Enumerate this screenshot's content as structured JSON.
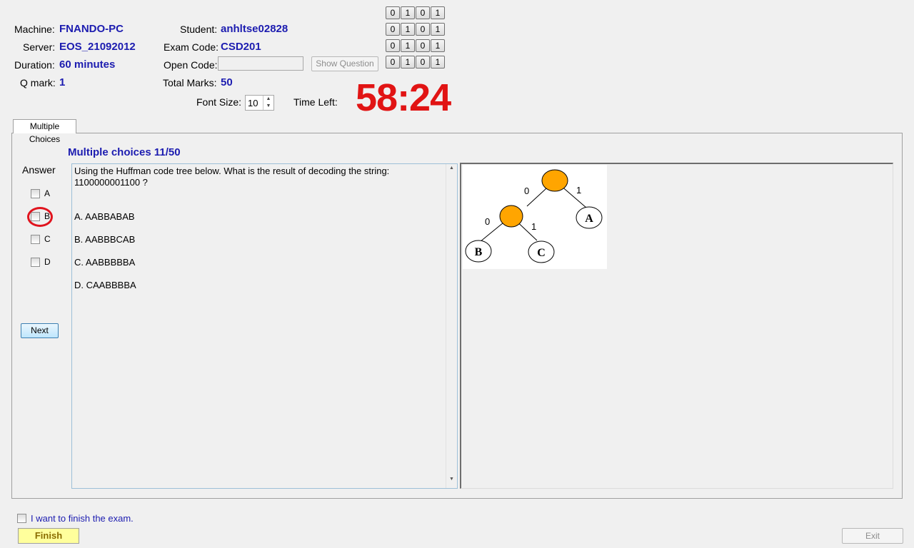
{
  "header": {
    "machine_label": "Machine:",
    "machine_value": "FNANDO-PC",
    "server_label": "Server:",
    "server_value": "EOS_21092012",
    "duration_label": "Duration:",
    "duration_value": "60 minutes",
    "qmark_label": "Q mark:",
    "qmark_value": "1",
    "student_label": "Student:",
    "student_value": "anhltse02828",
    "exam_code_label": "Exam Code:",
    "exam_code_value": "CSD201",
    "open_code_label": "Open Code:",
    "open_code_value": "",
    "show_question_label": "Show Question",
    "total_marks_label": "Total Marks:",
    "total_marks_value": "50",
    "font_size_label": "Font Size:",
    "font_size_value": "10",
    "time_left_label": "Time Left:",
    "time_left_value": "58:24"
  },
  "bit_rows": [
    [
      "0",
      "1",
      "0",
      "1"
    ],
    [
      "0",
      "1",
      "0",
      "1"
    ],
    [
      "0",
      "1",
      "0",
      "1"
    ],
    [
      "0",
      "1",
      "0",
      "1"
    ]
  ],
  "tab_label": "Multiple Choices",
  "question": {
    "title": "Multiple choices 11/50",
    "answer_label": "Answer",
    "choices": [
      "A",
      "B",
      "C",
      "D"
    ],
    "next_label": "Next",
    "text_line1": "Using the Huffman code tree below. What is the result of  decoding the string:",
    "text_line2": "1100000001100 ?",
    "options": [
      "A.  AABBABAB",
      "B.  AABBBCAB",
      "C.  AABBBBBA",
      "D.  CAABBBBA"
    ]
  },
  "diagram": {
    "edge_labels": [
      "0",
      "1",
      "0",
      "1"
    ],
    "leaves": [
      "A",
      "B",
      "C"
    ],
    "node_color": "#ffa500"
  },
  "footer": {
    "finish_check_label": "I want to finish the exam.",
    "finish_label": "Finish",
    "exit_label": "Exit"
  },
  "colors": {
    "value_blue": "#1c1cb0",
    "timer_red": "#e11414",
    "finish_yellow": "#ffff9c"
  }
}
